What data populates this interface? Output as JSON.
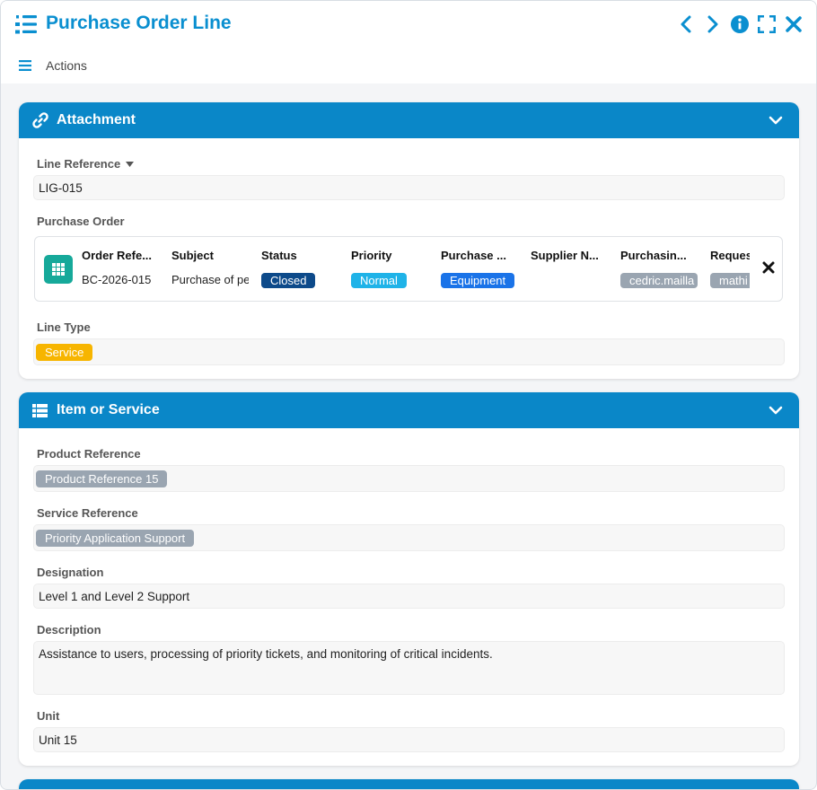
{
  "window": {
    "title": "Purchase Order Line",
    "actions_label": "Actions"
  },
  "colors": {
    "accent": "#0a87c8",
    "title": "#0a8fd0",
    "closed": "#0d4a8a",
    "normal": "#1fb3e8",
    "equipment": "#1a73e8",
    "gray_tag": "#9aa5b1",
    "service": "#f7b500",
    "po_icon": "#16a99a"
  },
  "attachment": {
    "header": "Attachment",
    "line_reference_label": "Line Reference",
    "line_reference_value": "LIG-015",
    "purchase_order_label": "Purchase Order",
    "purchase_order": {
      "columns": [
        {
          "header": "Order Refe...",
          "value": "BC-2026-015"
        },
        {
          "header": "Subject",
          "value": "Purchase of pe"
        },
        {
          "header": "Status",
          "tag": "Closed"
        },
        {
          "header": "Priority",
          "tag": "Normal"
        },
        {
          "header": "Purchase ...",
          "tag": "Equipment"
        },
        {
          "header": "Supplier N...",
          "value": ""
        },
        {
          "header": "Purchasin...",
          "tag": "cedric.mailla"
        },
        {
          "header": "Reques",
          "tag": "mathi"
        }
      ]
    },
    "line_type_label": "Line Type",
    "line_type_value": "Service"
  },
  "item_service": {
    "header": "Item or Service",
    "product_reference_label": "Product Reference",
    "product_reference_value": "Product Reference 15",
    "service_reference_label": "Service Reference",
    "service_reference_value": "Priority Application Support",
    "designation_label": "Designation",
    "designation_value": "Level 1 and Level 2 Support",
    "description_label": "Description",
    "description_value": "Assistance to users, processing of priority tickets, and monitoring of critical incidents.",
    "unit_label": "Unit",
    "unit_value": "Unit 15"
  }
}
